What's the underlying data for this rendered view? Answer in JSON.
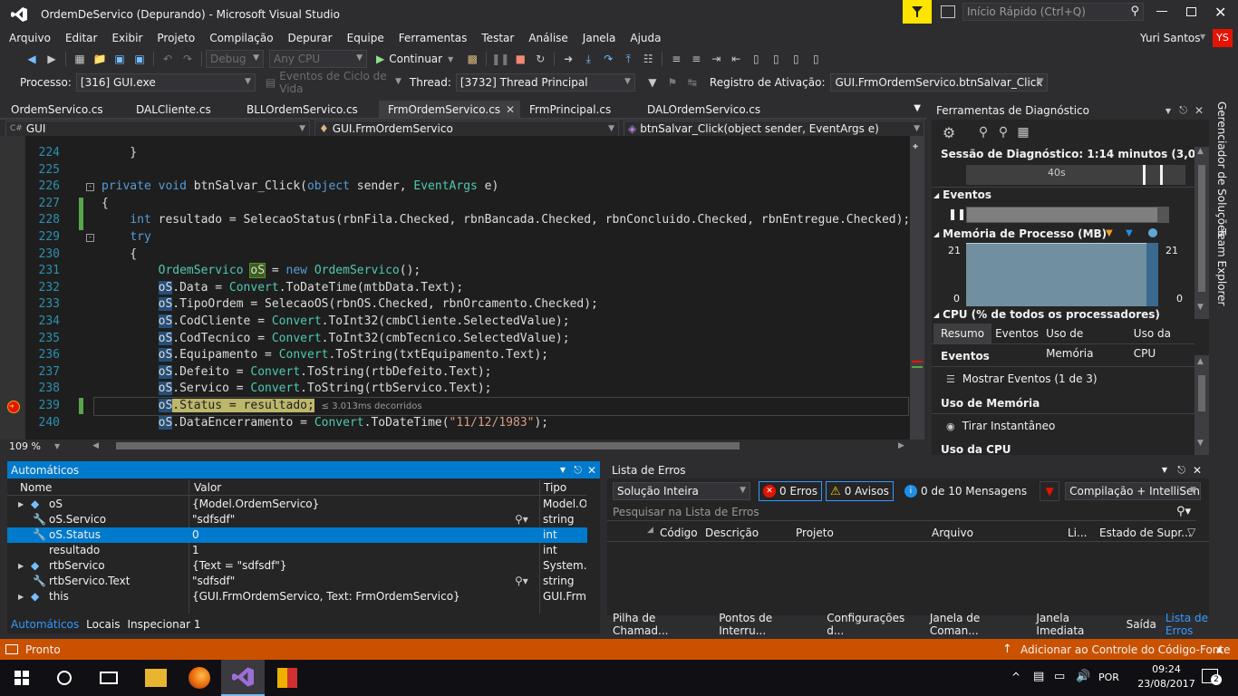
{
  "window": {
    "title": "OrdemDeServico (Depurando) - Microsoft Visual Studio",
    "quick_launch": "Início Rápido (Ctrl+Q)",
    "user": "Yuri Santos",
    "user_initials": "YS"
  },
  "menu": [
    "Arquivo",
    "Editar",
    "Exibir",
    "Projeto",
    "Compilação",
    "Depurar",
    "Equipe",
    "Ferramentas",
    "Testar",
    "Análise",
    "Janela",
    "Ajuda"
  ],
  "toolbar": {
    "config": "Debug",
    "platform": "Any CPU",
    "continue_label": "Continuar"
  },
  "debugbar": {
    "process_label": "Processo:",
    "process_value": "[316] GUI.exe",
    "lifecycle": "Eventos de Ciclo de Vida",
    "thread_label": "Thread:",
    "thread_value": "[3732] Thread Principal",
    "stackframe_label": "Registro de Ativação:",
    "stackframe_value": "GUI.FrmOrdemServico.btnSalvar_Click"
  },
  "doc_tabs": [
    "OrdemServico.cs",
    "DALCliente.cs",
    "BLLOrdemServico.cs",
    "FrmOrdemServico.cs",
    "FrmPrincipal.cs",
    "DALOrdemServico.cs"
  ],
  "nav": {
    "project": "GUI",
    "class": "GUI.FrmOrdemServico",
    "member": "btnSalvar_Click(object sender, EventArgs e)"
  },
  "code": {
    "lines": [
      {
        "n": "224",
        "text": "    }"
      },
      {
        "n": "225",
        "text": ""
      },
      {
        "n": "226",
        "text": "    private void btnSalvar_Click(object sender, EventArgs e)"
      },
      {
        "n": "227",
        "text": "    {"
      },
      {
        "n": "228",
        "text": "        int resultado = SelecaoStatus(rbnFila.Checked, rbnBancada.Checked, rbnConcluido.Checked, rbnEntregue.Checked);"
      },
      {
        "n": "229",
        "text": "        try"
      },
      {
        "n": "230",
        "text": "        {"
      },
      {
        "n": "231",
        "text": "            OrdemServico oS = new OrdemServico();"
      },
      {
        "n": "232",
        "text": "            oS.Data = Convert.ToDateTime(mtbData.Text);"
      },
      {
        "n": "233",
        "text": "            oS.TipoOrdem = SelecaoOS(rbnOS.Checked, rbnOrcamento.Checked);"
      },
      {
        "n": "234",
        "text": "            oS.CodCliente = Convert.ToInt32(cmbCliente.SelectedValue);"
      },
      {
        "n": "235",
        "text": "            oS.CodTecnico = Convert.ToInt32(cmbTecnico.SelectedValue);"
      },
      {
        "n": "236",
        "text": "            oS.Equipamento = Convert.ToString(txtEquipamento.Text);"
      },
      {
        "n": "237",
        "text": "            oS.Defeito = Convert.ToString(rtbDefeito.Text);"
      },
      {
        "n": "238",
        "text": "            oS.Servico = Convert.ToString(rtbServico.Text);"
      },
      {
        "n": "239",
        "text": "            oS.Status = resultado;"
      },
      {
        "n": "240",
        "text": "            oS.DataEncerramento = Convert.ToDateTime(\"11/12/1983\");"
      }
    ],
    "perf_tip": "≤ 3.013ms decorridos",
    "zoom": "109 %"
  },
  "diag": {
    "title": "Ferramentas de Diagnóstico",
    "session": "Sessão de Diagnóstico: 1:14 minutos (3,013 s sele...",
    "timeline_label": "40s",
    "events_label": "Eventos",
    "memory_label": "Memória de Processo (MB)",
    "mem_max": "21",
    "mem_min": "0",
    "cpu_label": "CPU (% de todos os processadores)",
    "tabs": [
      "Resumo",
      "Eventos",
      "Uso de Memória",
      "Uso da CPU"
    ],
    "sec_events": "Eventos",
    "show_events": "Mostrar Eventos (1 de 3)",
    "sec_memory": "Uso de Memória",
    "snapshot": "Tirar Instantâneo",
    "sec_cpu": "Uso da CPU"
  },
  "side_tabs": [
    "Gerenciador de Soluções",
    "Team Explorer"
  ],
  "autos": {
    "title": "Automáticos",
    "cols": [
      "Nome",
      "Valor",
      "Tipo"
    ],
    "rows": [
      {
        "name": "oS",
        "value": "{Model.OrdemServico}",
        "type": "Model.O"
      },
      {
        "name": "oS.Servico",
        "value": "\"sdfsdf\"",
        "type": "string"
      },
      {
        "name": "oS.Status",
        "value": "0",
        "type": "int"
      },
      {
        "name": "resultado",
        "value": "1",
        "type": "int"
      },
      {
        "name": "rtbServico",
        "value": "{Text = \"sdfsdf\"}",
        "type": "System.W"
      },
      {
        "name": "rtbServico.Text",
        "value": "\"sdfsdf\"",
        "type": "string"
      },
      {
        "name": "this",
        "value": "{GUI.FrmOrdemServico, Text: FrmOrdemServico}",
        "type": "GUI.Frm"
      }
    ],
    "bottom_tabs": [
      "Automáticos",
      "Locais",
      "Inspecionar 1"
    ]
  },
  "errors": {
    "title": "Lista de Erros",
    "scope": "Solução Inteira",
    "errors_btn": "0 Erros",
    "warnings_btn": "0 Avisos",
    "messages_btn": "0 de 10 Mensagens",
    "build": "Compilação + IntelliSens",
    "search_placeholder": "Pesquisar na Lista de Erros",
    "cols": [
      "Código",
      "Descrição",
      "Projeto",
      "Arquivo",
      "Li...",
      "Estado de Supr..."
    ],
    "bottom_tabs": [
      "Pilha de Chamad...",
      "Pontos de Interru...",
      "Configurações d...",
      "Janela de Coman...",
      "Janela Imediata",
      "Saída",
      "Lista de Erros"
    ]
  },
  "status": {
    "ready": "Pronto",
    "source_control": "Adicionar ao Controle do Código-Fonte"
  },
  "taskbar": {
    "time": "09:24",
    "date": "23/08/2017",
    "lang": "POR",
    "notif": "2"
  },
  "colors": {
    "accent": "#007acc",
    "status_bar": "#ca5100",
    "highlight_yellow": "#ffe400"
  }
}
